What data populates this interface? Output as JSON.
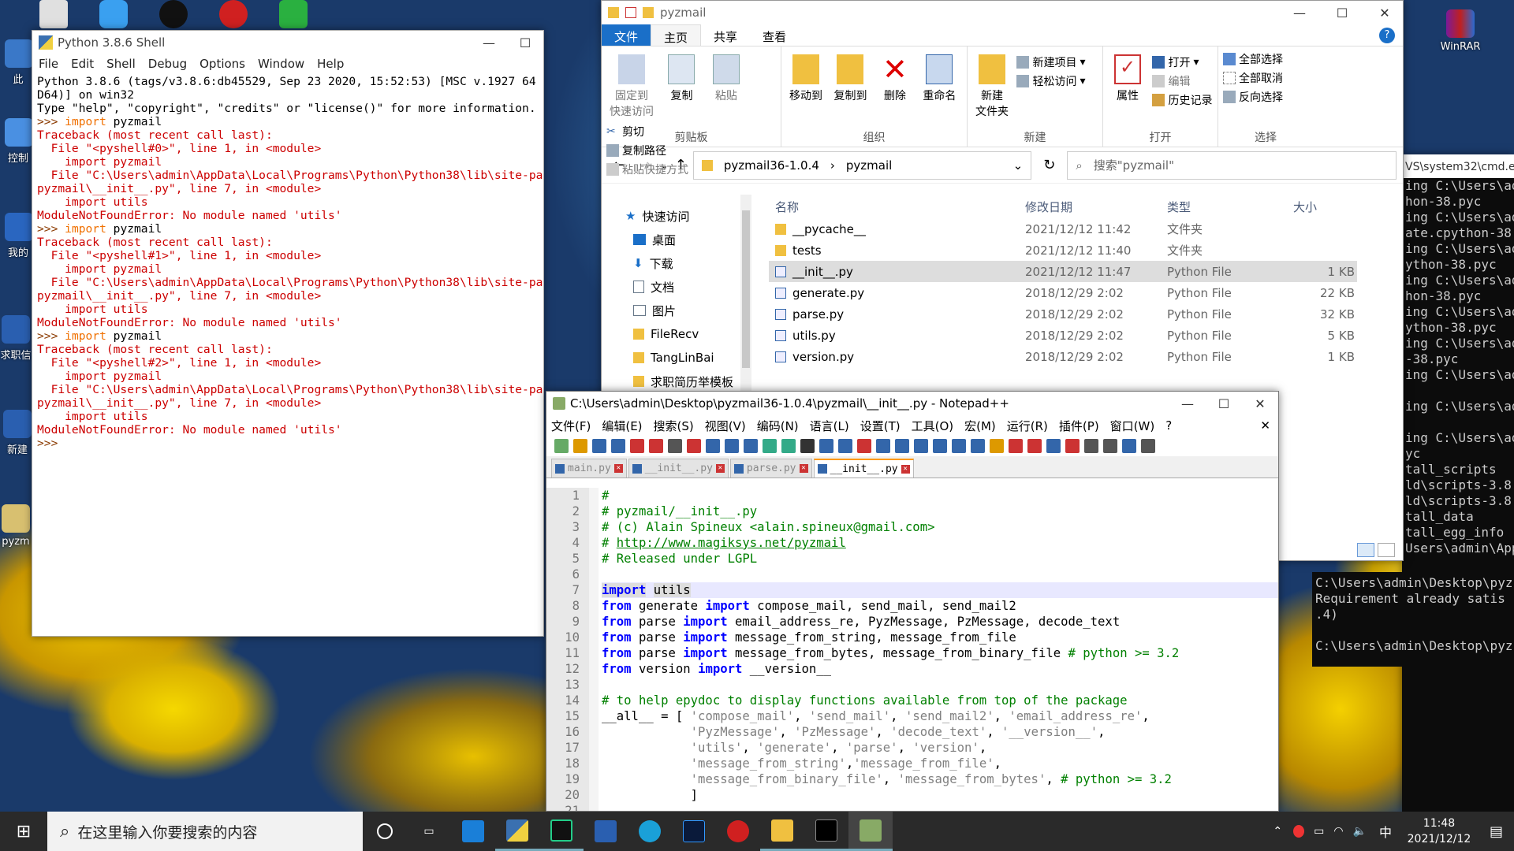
{
  "desktop": {
    "icons": [
      {
        "label": "此",
        "color": "#3a78c8"
      },
      {
        "label": "控制",
        "color": "#4a90e2"
      },
      {
        "label": "我的",
        "color": "#2a66c0"
      },
      {
        "label": "求职信",
        "color": "#2a5fb0"
      },
      {
        "label": "新建",
        "color": "#2a5fb0"
      },
      {
        "label": "pyzm",
        "color": "#d8c070"
      }
    ],
    "right_icon": {
      "label": "WinRAR"
    }
  },
  "idle": {
    "title": "Python 3.8.6 Shell",
    "menu": [
      "File",
      "Edit",
      "Shell",
      "Debug",
      "Options",
      "Window",
      "Help"
    ]
  },
  "explorer": {
    "title": "pyzmail",
    "tabs": [
      "文件",
      "主页",
      "共享",
      "查看"
    ],
    "clipboard": {
      "pin": "固定到\n快速访问",
      "copy": "复制",
      "paste": "粘贴",
      "cut": "剪切",
      "copy_path": "复制路径",
      "paste_shortcut": "粘贴快捷方式",
      "group": "剪贴板"
    },
    "organize": {
      "move": "移动到",
      "copyto": "复制到",
      "delete": "删除",
      "rename": "重命名",
      "group": "组织"
    },
    "new": {
      "folder": "新建\n文件夹",
      "item": "新建项目",
      "easy": "轻松访问",
      "group": "新建"
    },
    "open": {
      "props": "属性",
      "open": "打开",
      "edit": "编辑",
      "history": "历史记录",
      "group": "打开"
    },
    "select": {
      "all": "全部选择",
      "none": "全部取消",
      "invert": "反向选择",
      "group": "选择"
    },
    "path": [
      "pyzmail36-1.0.4",
      "pyzmail"
    ],
    "search_placeholder": "搜索\"pyzmail\"",
    "nav": [
      {
        "label": "快速访问"
      },
      {
        "label": "桌面"
      },
      {
        "label": "下载"
      },
      {
        "label": "文档"
      },
      {
        "label": "图片"
      },
      {
        "label": "FileRecv"
      },
      {
        "label": "TangLinBai"
      },
      {
        "label": "求职简历举模板"
      }
    ],
    "columns": [
      "名称",
      "修改日期",
      "类型",
      "大小"
    ],
    "files": [
      {
        "name": "__pycache__",
        "date": "2021/12/12 11:42",
        "type": "文件夹",
        "size": "",
        "folder": true
      },
      {
        "name": "tests",
        "date": "2021/12/12 11:40",
        "type": "文件夹",
        "size": "",
        "folder": true
      },
      {
        "name": "__init__.py",
        "date": "2021/12/12 11:47",
        "type": "Python File",
        "size": "1 KB",
        "selected": true
      },
      {
        "name": "generate.py",
        "date": "2018/12/29 2:02",
        "type": "Python File",
        "size": "22 KB"
      },
      {
        "name": "parse.py",
        "date": "2018/12/29 2:02",
        "type": "Python File",
        "size": "32 KB"
      },
      {
        "name": "utils.py",
        "date": "2018/12/29 2:02",
        "type": "Python File",
        "size": "5 KB"
      },
      {
        "name": "version.py",
        "date": "2018/12/29 2:02",
        "type": "Python File",
        "size": "1 KB"
      }
    ]
  },
  "cmd": {
    "title": "VS\\system32\\cmd.e"
  },
  "npp": {
    "title": "C:\\Users\\admin\\Desktop\\pyzmail36-1.0.4\\pyzmail\\__init__.py - Notepad++",
    "menu": [
      "文件(F)",
      "编辑(E)",
      "搜索(S)",
      "视图(V)",
      "编码(N)",
      "语言(L)",
      "设置(T)",
      "工具(O)",
      "宏(M)",
      "运行(R)",
      "插件(P)",
      "窗口(W)",
      "?"
    ],
    "tabs": [
      "main.py",
      "__init__.py",
      "parse.py",
      "__init__.py"
    ]
  },
  "taskbar": {
    "search": "在这里输入你要搜索的内容",
    "time": "11:48",
    "date": "2021/12/12",
    "ime": "中"
  }
}
